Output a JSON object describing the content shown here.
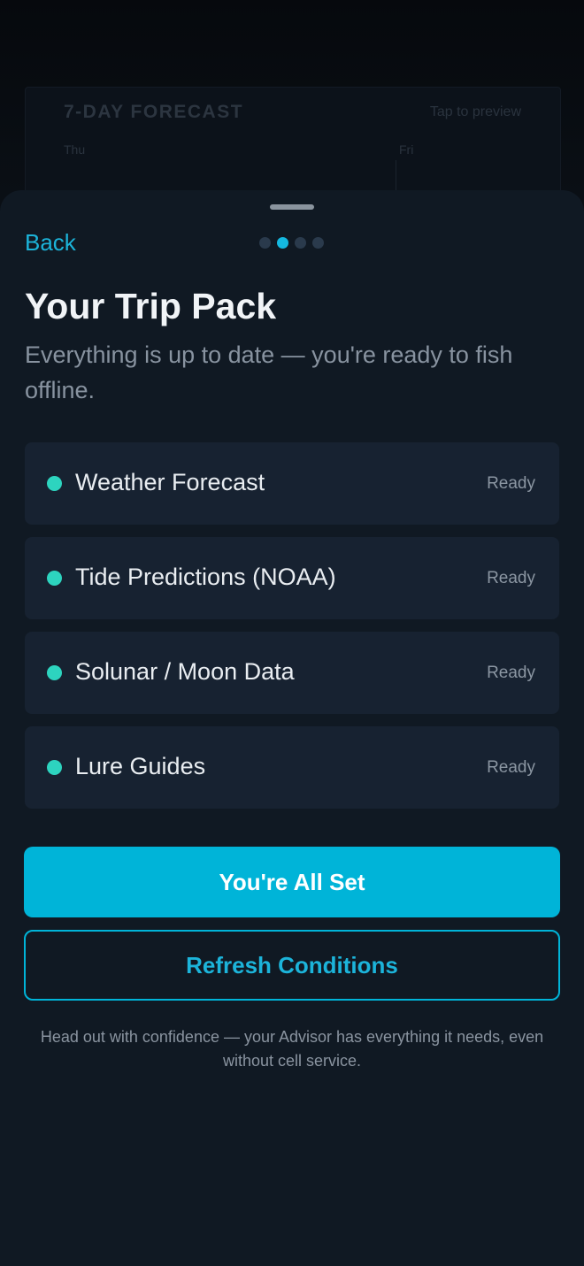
{
  "background": {
    "forecast_title": "7-DAY FORECAST",
    "forecast_hint": "Tap to preview",
    "days": [
      "Thu",
      "Fri"
    ]
  },
  "sheet": {
    "back_label": "Back",
    "pager": {
      "total": 4,
      "current": 2
    },
    "title": "Your Trip Pack",
    "subtitle": "Everything is up to date — you're ready to fish offline.",
    "items": [
      {
        "name": "Weather Forecast",
        "status": "Ready"
      },
      {
        "name": "Tide Predictions (NOAA)",
        "status": "Ready"
      },
      {
        "name": "Solunar / Moon Data",
        "status": "Ready"
      },
      {
        "name": "Lure Guides",
        "status": "Ready"
      }
    ],
    "primary_button": "You're All Set",
    "secondary_button": "Refresh Conditions",
    "footnote": "Head out with confidence — your Advisor has everything it needs, even without cell service."
  },
  "colors": {
    "accent": "#00b4d8",
    "ready_dot": "#2dd4bf",
    "sheet_bg": "#101923",
    "item_bg": "#172231"
  }
}
